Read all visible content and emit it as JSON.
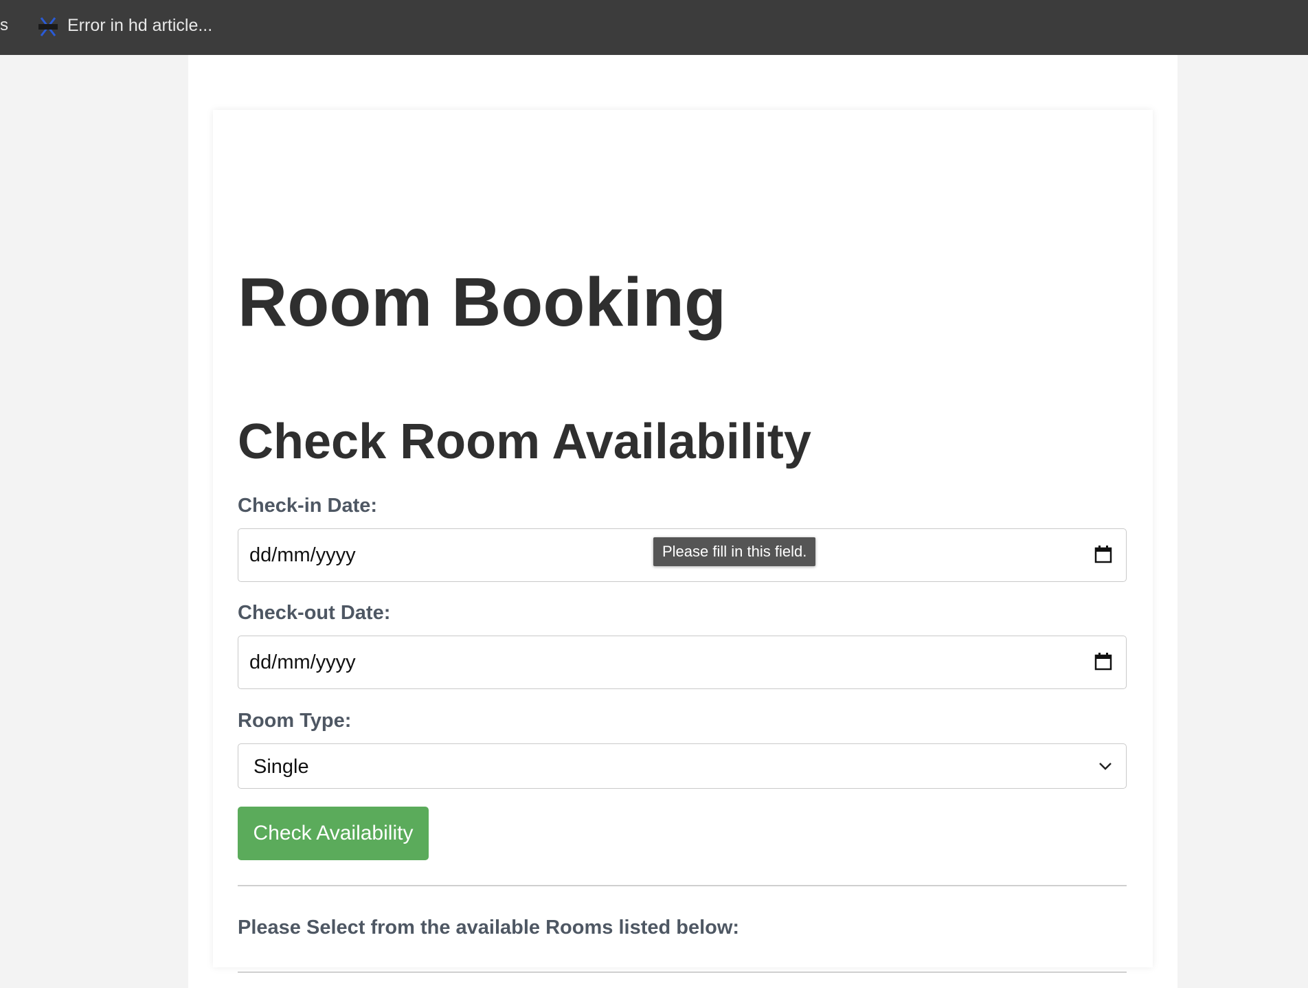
{
  "browser": {
    "prev_tab_fragment": "s",
    "tab_title": "Error in hd article..."
  },
  "page": {
    "title": "Room Booking",
    "section_title": "Check Room Availability",
    "checkin": {
      "label": "Check-in Date:",
      "value": "dd/mm/yyyy"
    },
    "checkout": {
      "label": "Check-out Date:",
      "value": "dd/mm/yyyy"
    },
    "room_type": {
      "label": "Room Type:",
      "selected": "Single"
    },
    "check_button_label": "Check Availability",
    "validation_tooltip": "Please fill in this field.",
    "rooms_note": "Please Select from the available Rooms listed below:"
  },
  "colors": {
    "button_green": "#5bab5b",
    "label_gray": "#4e5763",
    "heading": "#2f2f2f"
  }
}
